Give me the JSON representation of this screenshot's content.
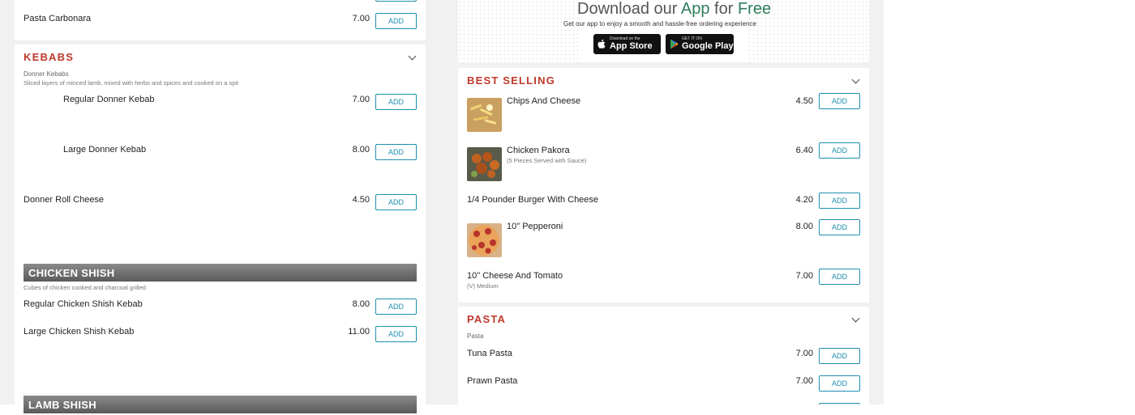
{
  "left": {
    "items_top": [
      {
        "name": "Pasta Carbonara",
        "price": "7.00",
        "add": "ADD"
      }
    ],
    "kebabs": {
      "title": "KEBABS",
      "group_title": "Donner Kebabs",
      "group_desc": "Sliced layers of minced lamb, mixed with herbs and spices and cooked on a spit",
      "items": [
        {
          "name": "Regular Donner Kebab",
          "price": "7.00",
          "add": "ADD"
        },
        {
          "name": "Large Donner Kebab",
          "price": "8.00",
          "add": "ADD"
        },
        {
          "name": "Donner Roll Cheese",
          "price": "4.50",
          "add": "ADD"
        }
      ]
    },
    "chicken_shish": {
      "title": "CHICKEN SHISH",
      "desc": "Cubes of chicken cooked and charcoal grilled",
      "items": [
        {
          "name": "Regular Chicken Shish Kebab",
          "price": "8.00",
          "add": "ADD"
        },
        {
          "name": "Large Chicken Shish Kebab",
          "price": "11.00",
          "add": "ADD"
        }
      ]
    },
    "lamb_shish": {
      "title": "LAMB SHISH"
    }
  },
  "right": {
    "download": {
      "title_pre": "Download our",
      "title_app": "App",
      "title_mid": "for",
      "title_free": "Free",
      "subtitle": "Get our app to enjoy a smooth and hassle-free ordering experience",
      "appstore_small": "Download on the",
      "appstore_big": "App Store",
      "gplay_small": "GET IT ON",
      "gplay_big": "Google Play"
    },
    "best_selling": {
      "title": "BEST SELLING",
      "items": [
        {
          "name": "Chips And Cheese",
          "price": "4.50",
          "add": "ADD",
          "note": ""
        },
        {
          "name": "Chicken Pakora",
          "price": "6.40",
          "add": "ADD",
          "note": "(5 Pieces Served with Sauce)"
        },
        {
          "name": "1/4 Pounder Burger With Cheese",
          "price": "4.20",
          "add": "ADD",
          "note": ""
        },
        {
          "name": "10\" Pepperoni",
          "price": "8.00",
          "add": "ADD",
          "note": ""
        },
        {
          "name": "10\" Cheese And Tomato",
          "price": "7.00",
          "add": "ADD",
          "note": "(V) Medium"
        }
      ]
    },
    "pasta": {
      "title": "PASTA",
      "group_title": "Pasta",
      "items": [
        {
          "name": "Tuna Pasta",
          "price": "7.00",
          "add": "ADD"
        },
        {
          "name": "Prawn Pasta",
          "price": "7.00",
          "add": "ADD"
        }
      ]
    }
  },
  "colors": {
    "accent": "#c0392b",
    "button": "#1e8fb0",
    "free": "#2e7d5b"
  },
  "icons": [
    "chevron-down-icon",
    "apple-icon",
    "google-play-icon"
  ]
}
